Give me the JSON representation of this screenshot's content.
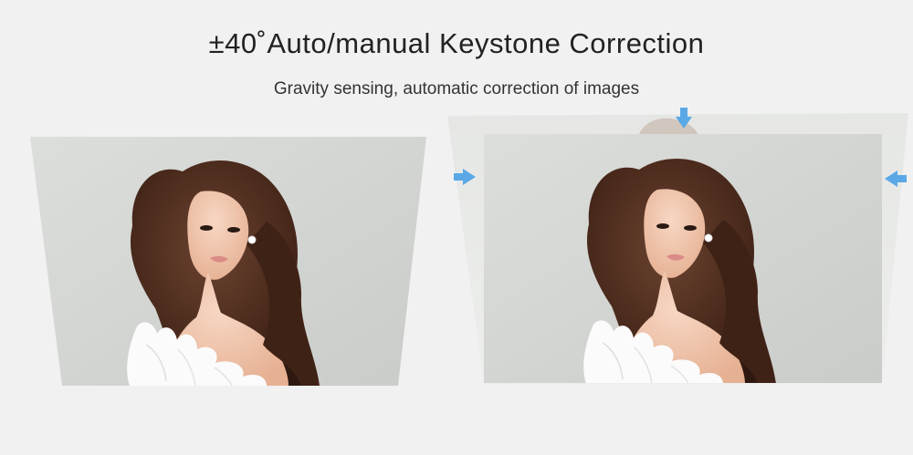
{
  "header": {
    "title": "±40˚Auto/manual Keystone Correction",
    "subtitle": "Gravity sensing, automatic correction of images"
  },
  "colors": {
    "background": "#f1f1f1",
    "arrow": "#5aa9e6",
    "photo_backdrop": "#d9dbd8",
    "hair": "#3e2418",
    "skin": "#efc3a8",
    "feathers": "#fbfbfb"
  },
  "icons": {
    "arrows": [
      "arrow-right-icon",
      "arrow-down-icon",
      "arrow-left-icon"
    ]
  }
}
